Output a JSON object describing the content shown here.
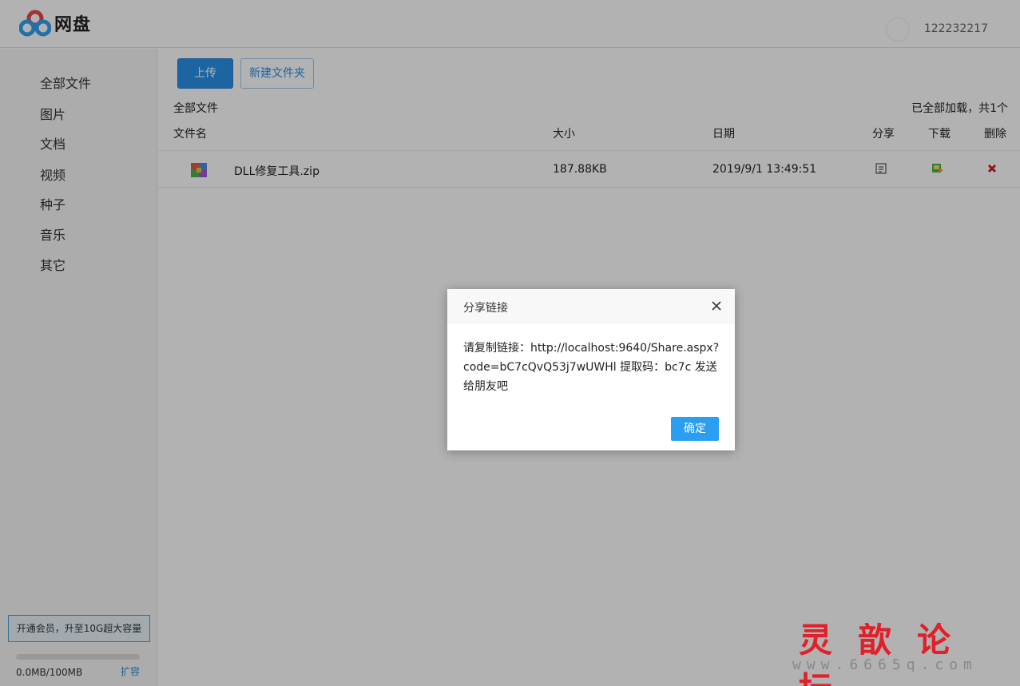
{
  "header": {
    "logo_text": "网盘",
    "username": "122232217"
  },
  "sidebar": {
    "items": [
      {
        "label": "全部文件"
      },
      {
        "label": "图片"
      },
      {
        "label": "文档"
      },
      {
        "label": "视频"
      },
      {
        "label": "种子"
      },
      {
        "label": "音乐"
      },
      {
        "label": "其它"
      }
    ],
    "vip_label": "开通会员，升至10G超大容量",
    "quota_text": "0.0MB/100MB",
    "quota_used_fraction": 0.0,
    "expand_label": "扩容"
  },
  "toolbar": {
    "upload_label": "上传",
    "new_folder_label": "新建文件夹"
  },
  "breadcrumb": "全部文件",
  "load_status": "已全部加载，共1个",
  "table": {
    "headers": {
      "name": "文件名",
      "size": "大小",
      "date": "日期",
      "share": "分享",
      "download": "下载",
      "delete": "删除"
    },
    "rows": [
      {
        "name": "DLL修复工具.zip",
        "size": "187.88KB",
        "date": "2019/9/1 13:49:51",
        "icon": "zip-archive-icon"
      }
    ]
  },
  "dialog": {
    "title": "分享链接",
    "body": "请复制链接：http://localhost:9640/Share.aspx?code=bC7cQvQ53j7wUWHl 提取码：bc7c 发送给朋友吧",
    "ok_label": "确定"
  },
  "watermark": {
    "title": "灵歆论坛",
    "url": "www.6665q.com"
  },
  "colors": {
    "accent": "#2a91e8",
    "watermark_red": "#e0202a"
  }
}
